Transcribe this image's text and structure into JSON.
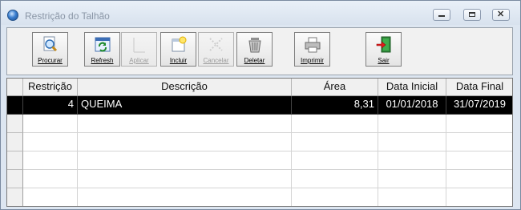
{
  "window": {
    "title": "Restrição do Talhão"
  },
  "toolbar": {
    "buttons": [
      {
        "label": "Procurar",
        "icon": "search-icon",
        "enabled": true
      },
      {
        "label": "Refresh",
        "icon": "refresh-icon",
        "enabled": true
      },
      {
        "label": "Aplicar",
        "icon": "apply-icon",
        "enabled": false
      },
      {
        "label": "Incluir",
        "icon": "new-document-icon",
        "enabled": true
      },
      {
        "label": "Cancelar",
        "icon": "cancel-icon",
        "enabled": false
      },
      {
        "label": "Deletar",
        "icon": "trash-icon",
        "enabled": true
      },
      {
        "label": "Imprimir",
        "icon": "printer-icon",
        "enabled": true
      },
      {
        "label": "Sair",
        "icon": "exit-door-icon",
        "enabled": true
      }
    ]
  },
  "grid": {
    "columns": [
      "Restrição",
      "Descrição",
      "Área",
      "Data Inicial",
      "Data Final"
    ],
    "rows": [
      [
        "4",
        "QUEIMA",
        "8,31",
        "01/01/2018",
        "31/07/2019"
      ],
      [
        "",
        "",
        "",
        "",
        ""
      ],
      [
        "",
        "",
        "",
        "",
        ""
      ],
      [
        "",
        "",
        "",
        "",
        ""
      ],
      [
        "",
        "",
        "",
        "",
        ""
      ],
      [
        "",
        "",
        "",
        "",
        ""
      ]
    ]
  },
  "colors": {
    "selected_row_bg": "#000000",
    "selected_row_text": "#ffffff"
  }
}
